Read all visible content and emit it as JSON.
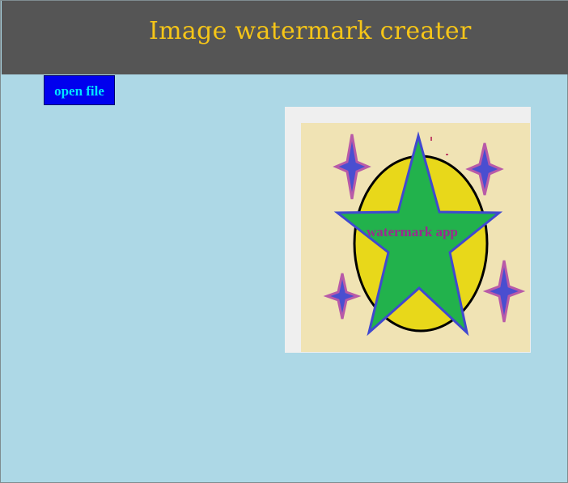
{
  "header": {
    "title": "Image watermark creater"
  },
  "toolbar": {
    "open_file_label": "open file"
  },
  "preview": {
    "watermark_text": "watermark app"
  },
  "colors": {
    "header_bg": "#555555",
    "title": "#f5c518",
    "page_bg": "#add8e6",
    "button_bg": "#0000ee",
    "button_text": "#00e5ff"
  }
}
